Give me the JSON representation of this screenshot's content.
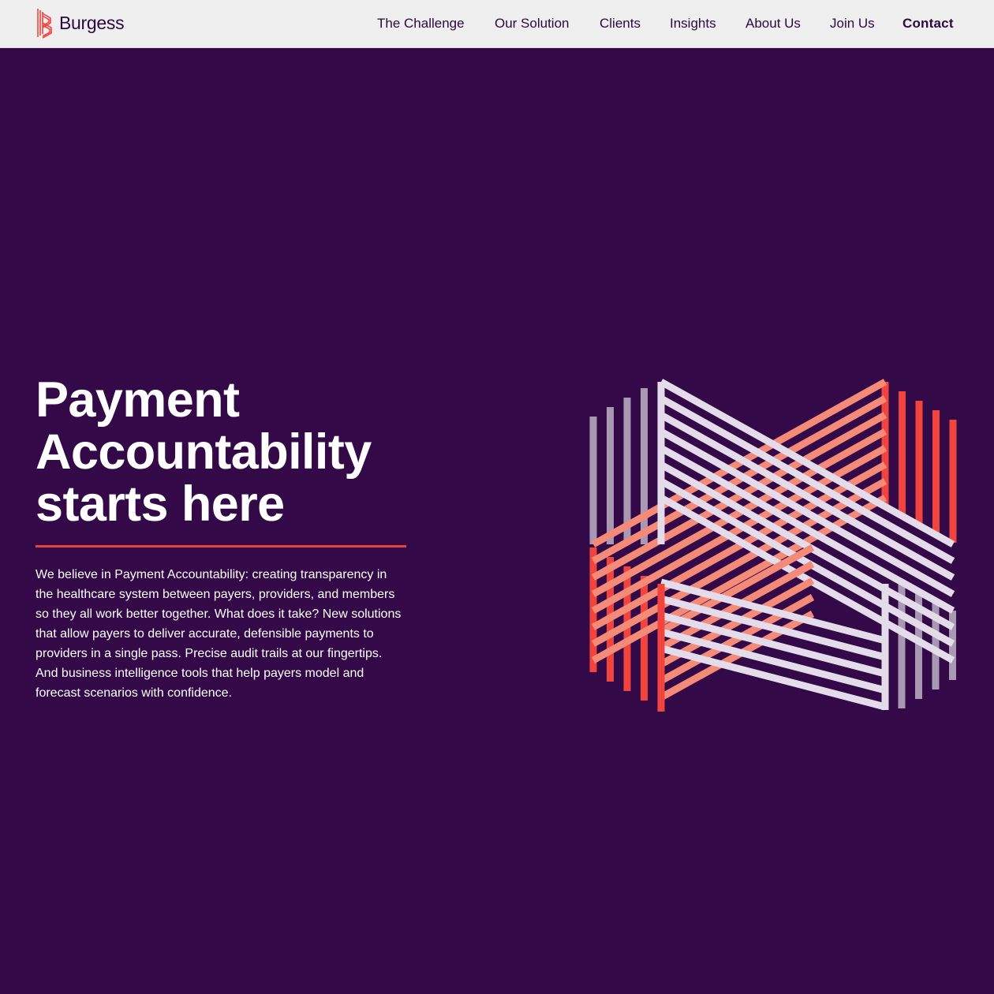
{
  "header": {
    "logo_text": "Burgess",
    "logo_icon": "burgess-mark-icon",
    "nav": [
      {
        "label": "The Challenge"
      },
      {
        "label": "Our Solution"
      },
      {
        "label": "Clients"
      },
      {
        "label": "Insights"
      },
      {
        "label": "About Us"
      },
      {
        "label": "Join Us"
      },
      {
        "label": "Contact"
      }
    ]
  },
  "hero": {
    "title_lines": [
      "Payment",
      "Accountability",
      "starts here"
    ],
    "body": "We believe in Payment Accountability: creating transparency in the healthcare system between payers, providers, and members so they all work better together. What does it take? New solutions that allow payers to deliver accurate, defensible payments to providers in a single pass. Precise audit trails at our fingertips. And business intelligence tools that help payers model and forecast scenarios with confidence.",
    "graphic": "interlocking-striped-emblem"
  },
  "colors": {
    "background": "#330a47",
    "header_bg": "#efefef",
    "brand_dark": "#2a0a3f",
    "accent_red": "#f2443f",
    "accent_coral": "#f48a78",
    "stripe_light": "#e4dcea",
    "stripe_muted": "#a998b3"
  }
}
